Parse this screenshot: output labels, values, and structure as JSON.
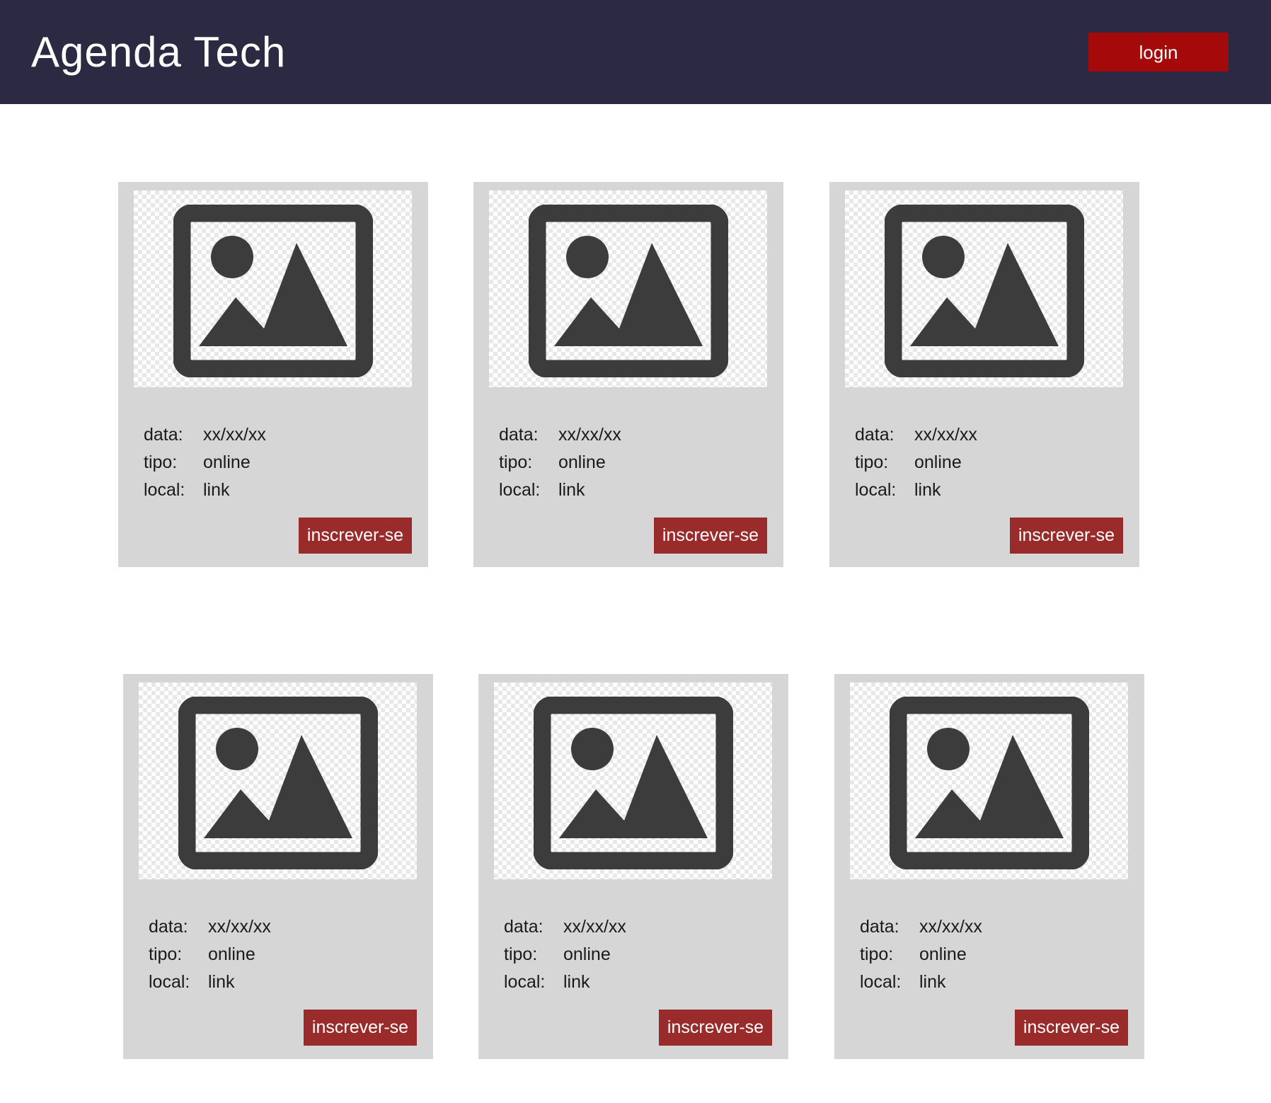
{
  "header": {
    "title": "Agenda Tech",
    "login_label": "login"
  },
  "colors": {
    "header_bg": "#2b2a42",
    "login_button": "#a40a0a",
    "card_bg": "#d6d6d6",
    "subscribe_button": "#992b2b",
    "icon": "#3c3c3c"
  },
  "cards": [
    {
      "image_icon": "image-placeholder-icon",
      "date_label": "data:",
      "date_value": "xx/xx/xx",
      "type_label": "tipo:",
      "type_value": "online",
      "place_label": "local:",
      "place_value": "link",
      "button_label": "inscrever-se"
    },
    {
      "image_icon": "image-placeholder-icon",
      "date_label": "data:",
      "date_value": "xx/xx/xx",
      "type_label": "tipo:",
      "type_value": "online",
      "place_label": "local:",
      "place_value": "link",
      "button_label": "inscrever-se"
    },
    {
      "image_icon": "image-placeholder-icon",
      "date_label": "data:",
      "date_value": "xx/xx/xx",
      "type_label": "tipo:",
      "type_value": "online",
      "place_label": "local:",
      "place_value": "link",
      "button_label": "inscrever-se"
    },
    {
      "image_icon": "image-placeholder-icon",
      "date_label": "data:",
      "date_value": "xx/xx/xx",
      "type_label": "tipo:",
      "type_value": "online",
      "place_label": "local:",
      "place_value": "link",
      "button_label": "inscrever-se"
    },
    {
      "image_icon": "image-placeholder-icon",
      "date_label": "data:",
      "date_value": "xx/xx/xx",
      "type_label": "tipo:",
      "type_value": "online",
      "place_label": "local:",
      "place_value": "link",
      "button_label": "inscrever-se"
    },
    {
      "image_icon": "image-placeholder-icon",
      "date_label": "data:",
      "date_value": "xx/xx/xx",
      "type_label": "tipo:",
      "type_value": "online",
      "place_label": "local:",
      "place_value": "link",
      "button_label": "inscrever-se"
    }
  ]
}
